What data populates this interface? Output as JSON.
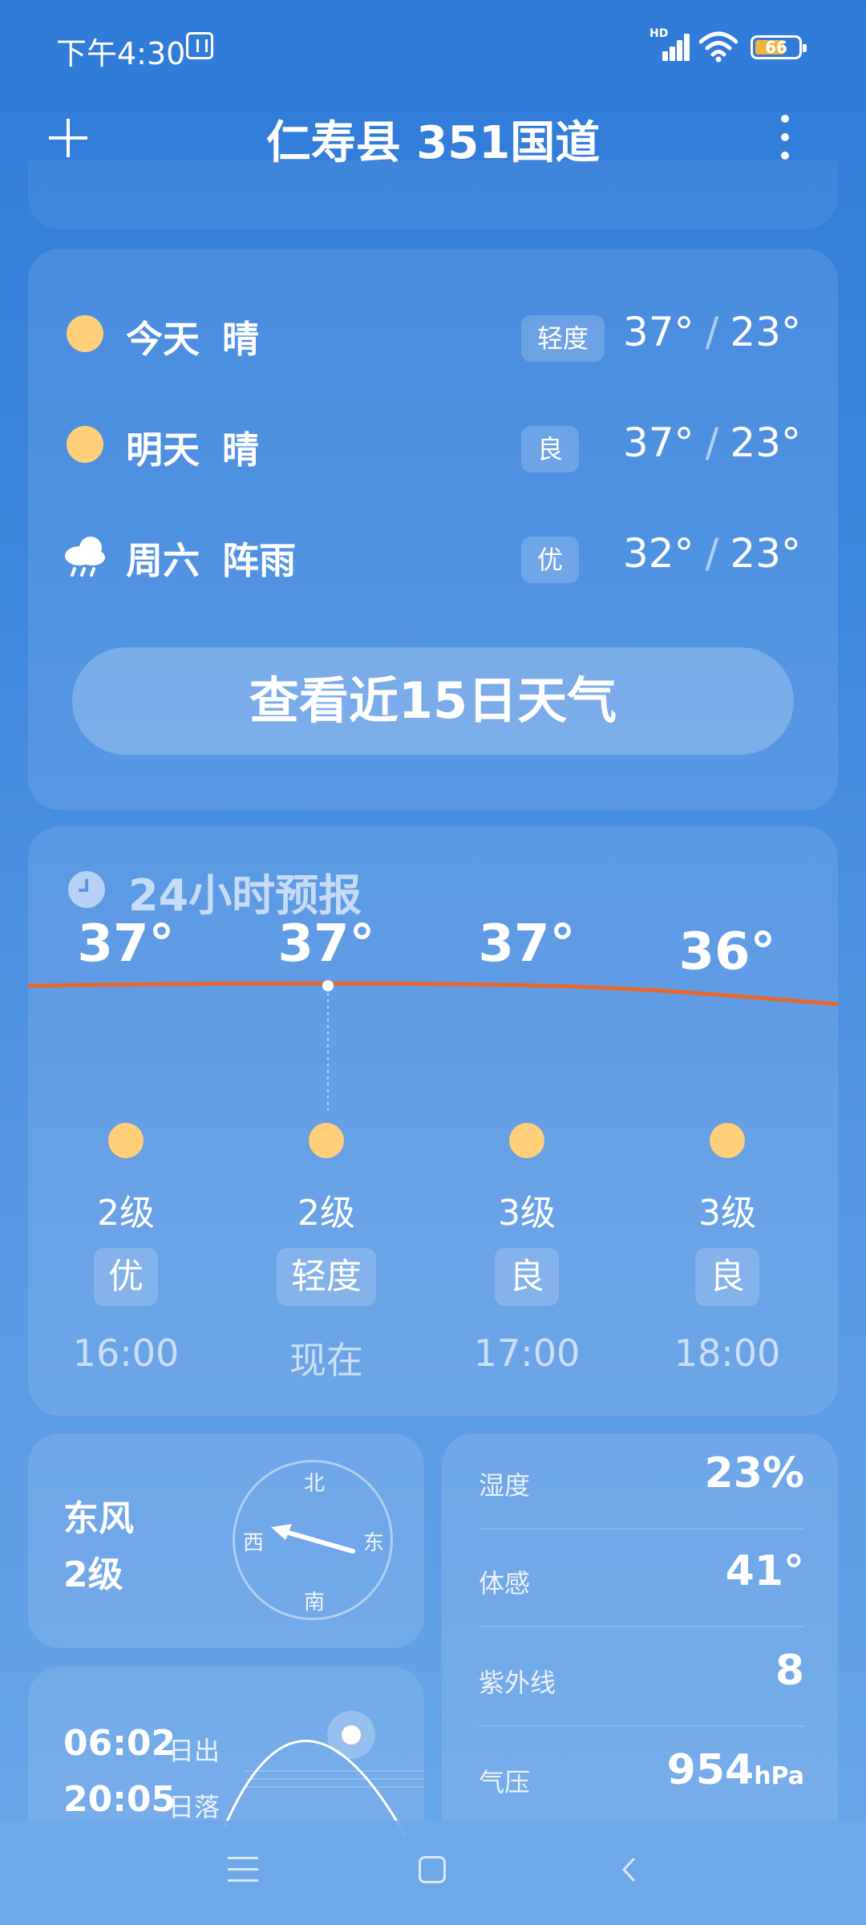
{
  "status_bar": {
    "time": "下午4:30",
    "network": "HD",
    "battery": "66"
  },
  "header": {
    "location": "仁寿县 351国道"
  },
  "daily_forecast": [
    {
      "day": "今天",
      "condition": "晴",
      "aqi": "轻度",
      "high": "37°",
      "low": "23°",
      "icon": "sun-icon"
    },
    {
      "day": "明天",
      "condition": "晴",
      "aqi": "良",
      "high": "37°",
      "low": "23°",
      "icon": "sun-icon"
    },
    {
      "day": "周六",
      "condition": "阵雨",
      "aqi": "优",
      "high": "32°",
      "low": "23°",
      "icon": "shower-icon"
    }
  ],
  "forecast_15day_button": "查看近15日天气",
  "hourly": {
    "title": "24小时预报",
    "items": [
      {
        "temp": "37°",
        "wind": "2级",
        "aqi": "优",
        "time": "16:00"
      },
      {
        "temp": "37°",
        "wind": "2级",
        "aqi": "轻度",
        "time": "现在"
      },
      {
        "temp": "37°",
        "wind": "3级",
        "aqi": "良",
        "time": "17:00"
      },
      {
        "temp": "36°",
        "wind": "3级",
        "aqi": "良",
        "time": "18:00"
      }
    ]
  },
  "wind": {
    "direction": "东风",
    "level": "2级",
    "compass": {
      "n": "北",
      "s": "南",
      "e": "东",
      "w": "西"
    }
  },
  "details": [
    {
      "label": "湿度",
      "value": "23%",
      "unit": ""
    },
    {
      "label": "体感",
      "value": "41°",
      "unit": ""
    },
    {
      "label": "紫外线",
      "value": "8",
      "unit": ""
    },
    {
      "label": "气压",
      "value": "954",
      "unit": "hPa"
    }
  ],
  "sun": {
    "sunrise": "06:02",
    "sunrise_label": "日出",
    "sunset": "20:05",
    "sunset_label": "日落"
  },
  "colors": {
    "accent_sun": "#ffcf7a",
    "temp_line": "#e8682e",
    "battery": "#f0b43c"
  }
}
